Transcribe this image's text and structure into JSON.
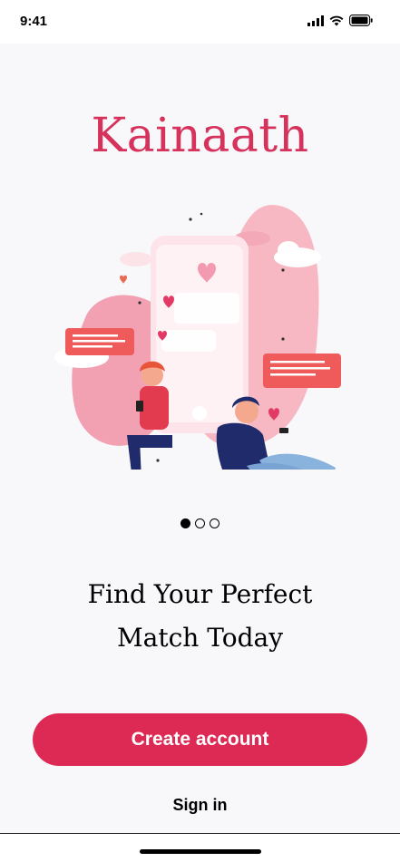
{
  "status_bar": {
    "time": "9:41"
  },
  "brand": {
    "name": "Kainaath"
  },
  "onboarding": {
    "page_count": 3,
    "active_page": 1,
    "headline_line1": "Find Your Perfect",
    "headline_line2": "Match Today"
  },
  "actions": {
    "create_account_label": "Create account",
    "sign_in_label": "Sign in"
  },
  "colors": {
    "brand": "#d6325c",
    "button": "#dd2a55",
    "background": "#f8f8fb"
  }
}
